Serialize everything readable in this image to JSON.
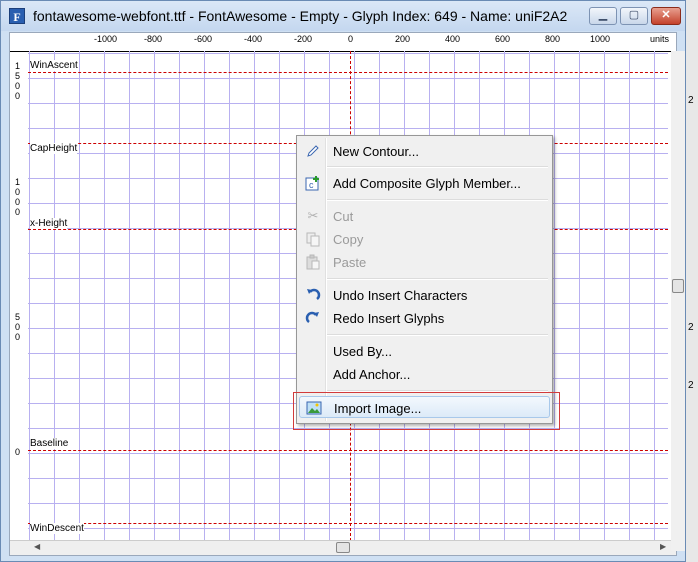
{
  "window": {
    "title": "fontawesome-webfont.ttf - FontAwesome - Empty - Glyph Index: 649 - Name: uniF2A2",
    "app_icon_glyph": "F",
    "controls": {
      "minimize": "▁",
      "maximize": "▢",
      "close": "✕"
    }
  },
  "ruler": {
    "h_ticks": [
      "-1000",
      "-800",
      "-600",
      "-400",
      "-200",
      "0",
      "200",
      "400",
      "600",
      "800",
      "1000",
      "units"
    ],
    "v_labels": [
      [
        "1",
        "5",
        "0",
        "0"
      ],
      [
        "1",
        "0",
        "0",
        "0"
      ],
      [
        "5",
        "0",
        "0"
      ],
      [
        "0"
      ]
    ]
  },
  "metrics": {
    "win_ascent": "WinAscent",
    "cap_height": "CapHeight",
    "x_height": "x-Height",
    "baseline": "Baseline",
    "win_descent": "WinDescent"
  },
  "context_menu": {
    "new_contour": "New Contour...",
    "add_composite": "Add Composite Glyph Member...",
    "cut": "Cut",
    "copy": "Copy",
    "paste": "Paste",
    "undo": "Undo Insert Characters",
    "redo": "Redo Insert Glyphs",
    "used_by": "Used By...",
    "add_anchor": "Add Anchor...",
    "import_image": "Import Image..."
  },
  "edge_fragments": [
    "2",
    "2",
    "2"
  ],
  "colors": {
    "grid": "#b8b0f0",
    "metric_line": "#cc0000",
    "highlight_box": "#d23b3b"
  }
}
